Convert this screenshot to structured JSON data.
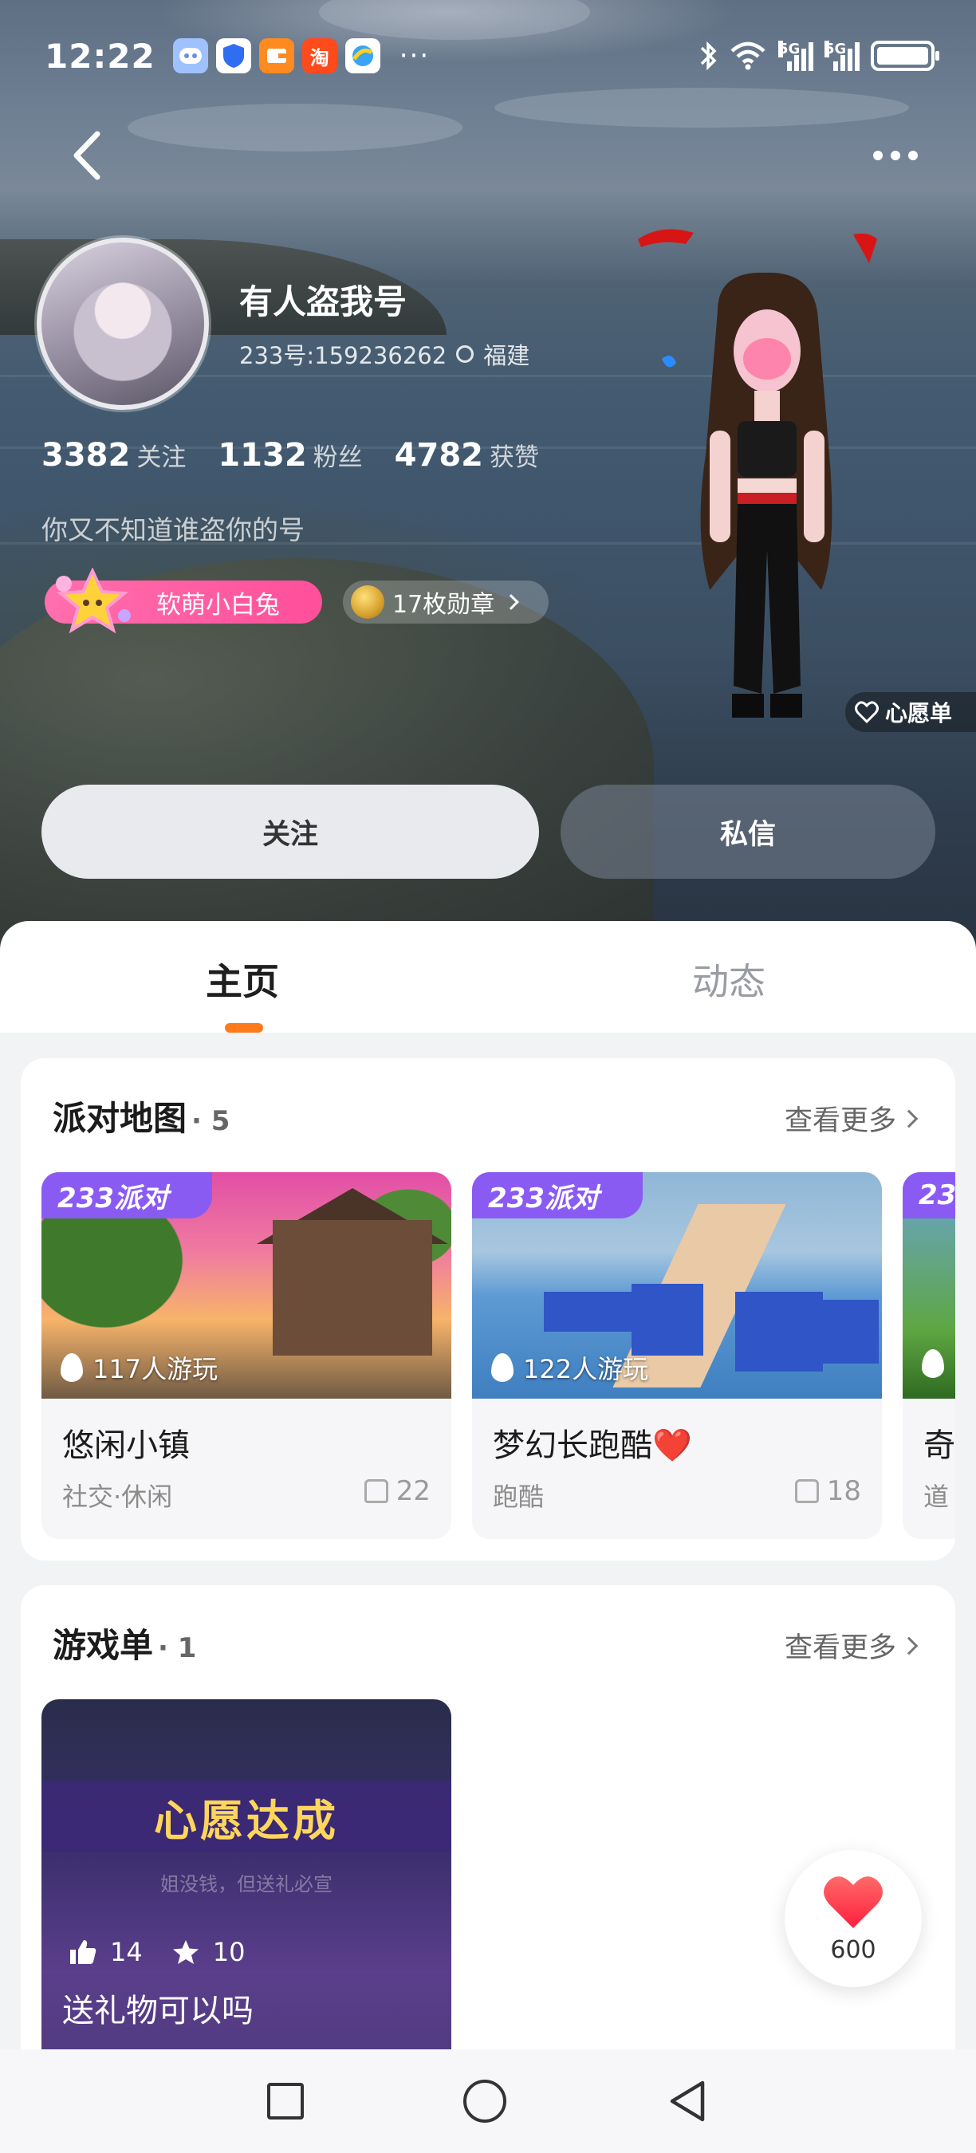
{
  "status_bar": {
    "time": "12:22",
    "notifications": [
      "bot-icon",
      "shield-icon",
      "wallet-icon",
      "taobao-icon",
      "browser-icon"
    ],
    "taobao_label": "淘",
    "more": "···",
    "network_1": "5G",
    "network_2": "5G"
  },
  "profile": {
    "username": "有人盗我号",
    "id_text": "233号:159236262",
    "location": "福建",
    "stats": [
      {
        "num": "3382",
        "label": "关注"
      },
      {
        "num": "1132",
        "label": "粉丝"
      },
      {
        "num": "4782",
        "label": "获赞"
      }
    ],
    "bio": "你又不知道谁盗你的号",
    "level_tag": "软萌小白兔",
    "badges_tag": "17枚勋章",
    "wishlist": "心愿单",
    "follow_label": "关注",
    "message_label": "私信"
  },
  "tabs": [
    {
      "label": "主页",
      "active": true
    },
    {
      "label": "动态",
      "active": false
    }
  ],
  "party_maps": {
    "title": "派对地图",
    "count": "· 5",
    "more": "查看更多",
    "items": [
      {
        "badge": "233派对",
        "players": "117人游玩",
        "name": "悠闲小镇",
        "tag": "社交·休闲",
        "likes": "22"
      },
      {
        "badge": "233派对",
        "players": "122人游玩",
        "name": "梦幻长跑酷❤️",
        "tag": "跑酷",
        "likes": "18"
      },
      {
        "badge": "23",
        "name": "奇",
        "tag": "道"
      }
    ]
  },
  "game_lists": {
    "title": "游戏单",
    "count": "· 1",
    "more": "查看更多",
    "item": {
      "banner": "心愿达成",
      "subtitle": "姐没钱，但送礼必宣",
      "likes": "14",
      "stars": "10",
      "name": "送礼物可以吗"
    }
  },
  "heart_fab": {
    "count": "600"
  },
  "colors": {
    "accent": "#ff7a1a",
    "party_badge": "#8a5bf3",
    "level_tag": "#ff4f9a"
  }
}
